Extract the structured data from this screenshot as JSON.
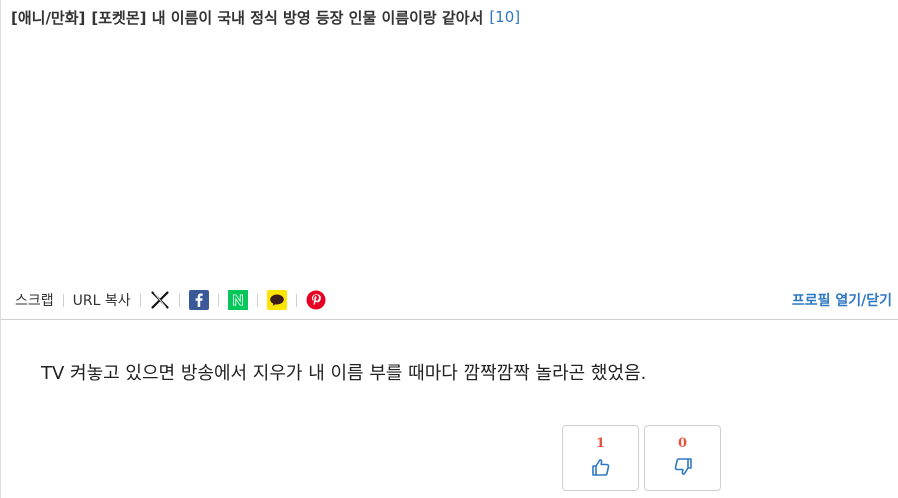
{
  "post": {
    "category": "[애니/만화]",
    "title": "[포켓몬] 내 이름이 국내 정식 방영 등장 인물 이름이랑 같아서",
    "comment_count": "[10]",
    "body": "TV 켜놓고 있으면 방송에서 지우가 내 이름 부를 때마다 깜짝깜짝 놀라곤 했었음."
  },
  "toolbar": {
    "scrap_label": "스크랩",
    "copy_url_label": "URL 복사",
    "share_icons": [
      "x-icon",
      "facebook-icon",
      "naver-icon",
      "kakaotalk-icon",
      "pinterest-icon"
    ],
    "profile_toggle_label": "프로필 열기/닫기"
  },
  "votes": {
    "up_count": "1",
    "down_count": "0"
  },
  "colors": {
    "link_blue": "#2f78c4",
    "vote_red": "#e5533d",
    "facebook": "#3b5998",
    "naver": "#03c75a",
    "kakao": "#fee500",
    "pinterest": "#e60023"
  }
}
